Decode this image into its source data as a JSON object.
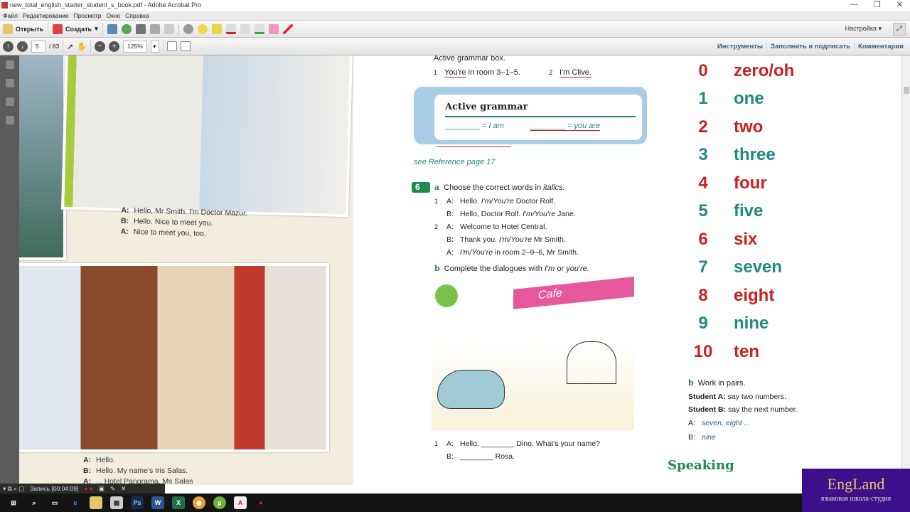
{
  "window": {
    "title": "new_total_english_starter_student_s_book.pdf - Adobe Acrobat Pro",
    "controls": [
      "—",
      "❐",
      "✕"
    ]
  },
  "menu": [
    "Файл",
    "Редактирование",
    "Просмотр",
    "Окно",
    "Справка"
  ],
  "toolbar": {
    "open": "Открыть",
    "create": "Создать",
    "customize": "Настройка"
  },
  "nav": {
    "page": "5",
    "total": "/ 83",
    "zoom": "125%"
  },
  "panels": [
    "Инструменты",
    "Заполнить и подписать",
    "Комментарии"
  ],
  "photo1_caption": [
    [
      "A:",
      "Hello, Mr Smith. I'm Doctor Mazur."
    ],
    [
      "B:",
      "Hello. Nice to meet you."
    ],
    [
      "A:",
      "Nice to meet you, too."
    ]
  ],
  "photo2_caption": [
    [
      "A:",
      "Hello."
    ],
    [
      "B:",
      "Hello. My name's Iris Salas."
    ],
    [
      "A:",
      "... Hotel Panorama, Ms Salas"
    ]
  ],
  "intro": "Active grammar box.",
  "examples": [
    {
      "n": "1",
      "bold": "You're",
      "rest": " in room 3–1–5."
    },
    {
      "n": "2",
      "bold": "I'm Clive.",
      "rest": ""
    }
  ],
  "grammar": {
    "title": "Active grammar",
    "left": "________ = ",
    "left_it": "I am",
    "right": "________ = ",
    "right_it": "you are"
  },
  "reference": "see Reference page 17",
  "ex6": {
    "num": "6",
    "a": "a",
    "a_text": "Choose the correct words in ",
    "a_it": "italics.",
    "lines": [
      [
        "1",
        "A:",
        "Hello. ",
        "I'm/You're",
        " Doctor Rolf."
      ],
      [
        "",
        "B:",
        "Hello, Doctor Rolf. ",
        "I'm/You're",
        " Jane."
      ],
      [
        "2",
        "A:",
        "Welcome to Hotel Central.",
        "",
        ""
      ],
      [
        "",
        "B:",
        "Thank you. ",
        "I'm/You're",
        " Mr Smith."
      ],
      [
        "",
        "A:",
        "",
        "I'm/You're",
        " in room 2–9–6, Mr Smith."
      ]
    ],
    "b": "b",
    "b_text": "Complete the dialogues with ",
    "b_it1": "I'm",
    "b_or": " or ",
    "b_it2": "you're.",
    "dlg": [
      [
        "1",
        "A:",
        "Hello. ________ Dino. What's your name?"
      ],
      [
        "",
        "B:",
        "________ Rosa."
      ]
    ],
    "cafe_sign": "Cafe"
  },
  "numbers": [
    [
      "0",
      "zero/oh"
    ],
    [
      "1",
      "one"
    ],
    [
      "2",
      "two"
    ],
    [
      "3",
      "three"
    ],
    [
      "4",
      "four"
    ],
    [
      "5",
      "five"
    ],
    [
      "6",
      "six"
    ],
    [
      "7",
      "seven"
    ],
    [
      "8",
      "eight"
    ],
    [
      "9",
      "nine"
    ],
    [
      "10",
      "ten"
    ]
  ],
  "colors": {
    "even": "#cc1f1f",
    "odd": "#1f8a80",
    "accent_green": "#1f8a4c"
  },
  "pairs": {
    "b": "b",
    "title": "Work in pairs.",
    "sa_label": "Student A:",
    "sa": " say two numbers.",
    "sb_label": "Student B:",
    "sb": " say the next number.",
    "a": "A:",
    "a_it": "seven, eight ...",
    "bl": "B:",
    "b_it": "nine"
  },
  "speaking": "Speaking",
  "recorder": {
    "label": "Запись [00:04:09]"
  },
  "taskbar": [
    "⊞",
    "⌕",
    "▭",
    "e",
    "📁",
    "▦",
    "Ps",
    "W",
    "X",
    "◉",
    "µ",
    "A",
    "●"
  ],
  "watermark": {
    "logo": "EngLand",
    "sub": "языковая школа-студия"
  }
}
